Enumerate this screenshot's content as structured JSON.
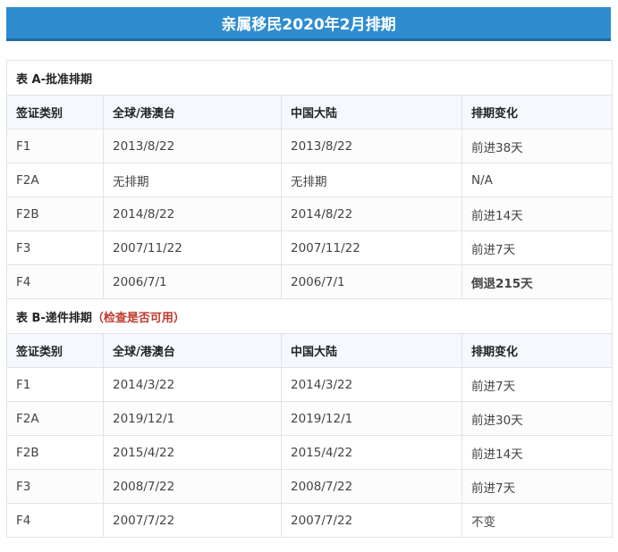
{
  "banner_title": "亲属移民2020年2月排期",
  "colors": {
    "banner": "#2f8ccf",
    "note": "#c0392b",
    "retrogress": "#8b1a1a"
  },
  "table_a": {
    "caption": "表 A-批准排期",
    "headers": [
      "签证类别",
      "全球/港澳台",
      "中国大陆",
      "排期变化"
    ],
    "rows": [
      [
        "F1",
        "2013/8/22",
        "2013/8/22",
        "前进38天"
      ],
      [
        "F2A",
        "无排期",
        "无排期",
        "N/A"
      ],
      [
        "F2B",
        "2014/8/22",
        "2014/8/22",
        "前进14天"
      ],
      [
        "F3",
        "2007/11/22",
        "2007/11/22",
        "前进7天"
      ],
      [
        "F4",
        "2006/7/1",
        "2006/7/1",
        "倒退215天"
      ]
    ]
  },
  "table_b": {
    "caption": "表 B-递件排期",
    "caption_note": "（检查是否可用）",
    "headers": [
      "签证类别",
      "全球/港澳台",
      "中国大陆",
      "排期变化"
    ],
    "rows": [
      [
        "F1",
        "2014/3/22",
        "2014/3/22",
        "前进7天"
      ],
      [
        "F2A",
        "2019/12/1",
        "2019/12/1",
        "前进30天"
      ],
      [
        "F2B",
        "2015/4/22",
        "2015/4/22",
        "前进14天"
      ],
      [
        "F3",
        "2008/7/22",
        "2008/7/22",
        "前进7天"
      ],
      [
        "F4",
        "2007/7/22",
        "2007/7/22",
        "不变"
      ]
    ]
  }
}
